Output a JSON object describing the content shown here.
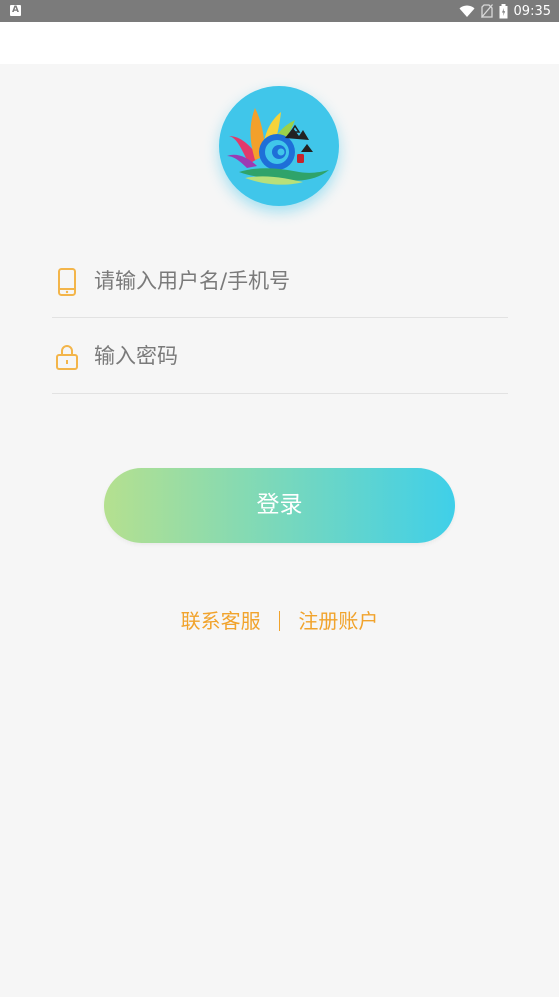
{
  "status_bar": {
    "notification_icon": "A",
    "time": "09:35"
  },
  "login": {
    "username_placeholder": "请输入用户名/手机号",
    "password_placeholder": "输入密码",
    "submit_label": "登录"
  },
  "links": {
    "contact_service": "联系客服",
    "separator": "|",
    "register_account": "注册账户"
  },
  "colors": {
    "accent": "#f1a32c",
    "button_gradient_start": "#b5e08f",
    "button_gradient_end": "#3fcfe9",
    "logo_bg": "#40c6ea"
  }
}
